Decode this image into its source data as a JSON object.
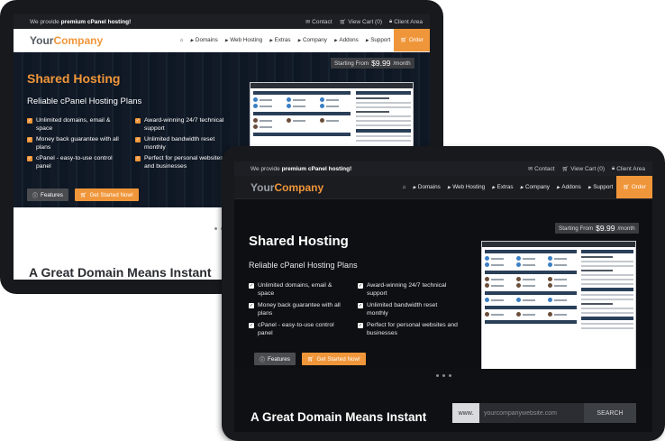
{
  "site": {
    "tagline_prefix": "We provide",
    "tagline_bold": "premium cPanel hosting!",
    "links": {
      "contact": "Contact",
      "cart": "View Cart (0)",
      "client_area": "Client Area"
    },
    "logo": {
      "part1": "Your",
      "part2": "Company"
    },
    "menu": [
      "Domains",
      "Web Hosting",
      "Extras",
      "Company",
      "Addons",
      "Support"
    ],
    "order_label": "Order"
  },
  "hero": {
    "title": "Shared Hosting",
    "subtitle": "Reliable cPanel Hosting Plans",
    "features": [
      "Unlimited domains, email & space",
      "Award-winning 24/7 technical support",
      "Money back guarantee with all plans",
      "Unlimited bandwidth reset monthly",
      "cPanel - easy-to-use control panel",
      "Perfect for personal websites and businesses"
    ],
    "features_button": "Features",
    "start_button": "Get Started Now!",
    "price": {
      "prefix": "Starting From",
      "amount": "$9.99",
      "suffix": "/month"
    }
  },
  "domain": {
    "title": "A Great Domain Means Instant",
    "prefix": "www.",
    "placeholder": "yourcompanywebsite.com",
    "search_button": "SEARCH"
  },
  "colors": {
    "accent": "#f0963a",
    "dark_bg": "#0f1013",
    "frame": "#17191d"
  },
  "icons": {
    "contact": "envelope-icon",
    "cart": "cart-icon",
    "client": "lock-icon",
    "home": "home-icon",
    "check": "check-icon"
  }
}
